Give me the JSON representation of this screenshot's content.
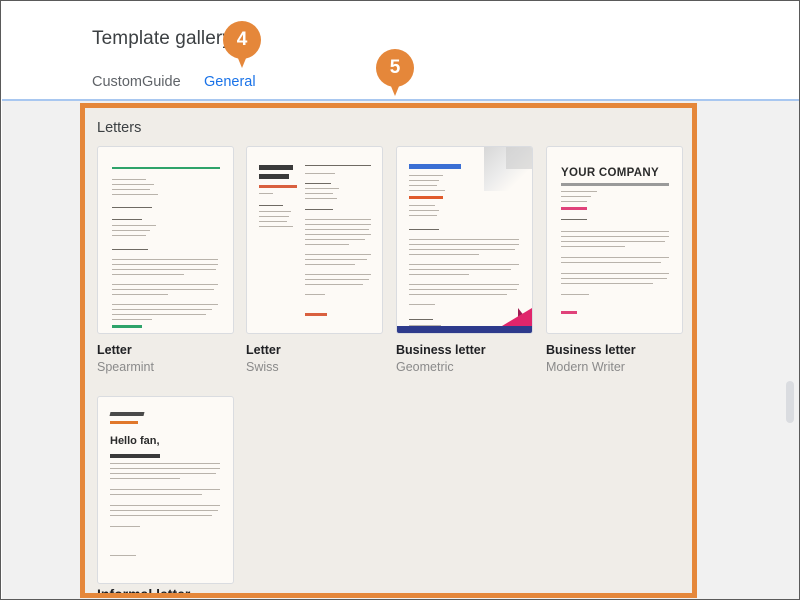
{
  "header": {
    "title": "Template gallery",
    "tabs": [
      {
        "label": "CustomGuide",
        "active": false
      },
      {
        "label": "General",
        "active": true
      }
    ]
  },
  "callouts": [
    {
      "number": "4",
      "target": "template-gallery-title"
    },
    {
      "number": "5",
      "target": "template-gallery-list"
    }
  ],
  "gallery": {
    "sections": [
      {
        "heading": "Letters",
        "templates": [
          {
            "title": "Letter",
            "subtitle": "Spearmint",
            "accent": "#2ea36a"
          },
          {
            "title": "Letter",
            "subtitle": "Swiss",
            "accent": "#d9603f"
          },
          {
            "title": "Business letter",
            "subtitle": "Geometric",
            "accent": "#3b6fd4"
          },
          {
            "title": "Business letter",
            "subtitle": "Modern Writer",
            "accent": "#e0427a"
          },
          {
            "title": "Informal letter",
            "subtitle": "",
            "accent": "#e0772b"
          }
        ]
      }
    ],
    "next_section_heading": "Informal letter",
    "thumb_text": {
      "modern_writer_title": "YOUR COMPANY",
      "informal_greeting": "Hello fan,"
    }
  },
  "colors": {
    "callout_orange": "#e5873a",
    "tab_active_blue": "#1a73e8",
    "gallery_background": "#f0ede8",
    "viewport_background": "#f1f1f1",
    "divider_blue": "#a8c7f0"
  },
  "scrollbar": {
    "orientation": "vertical",
    "thumb_position_percent": 57
  }
}
